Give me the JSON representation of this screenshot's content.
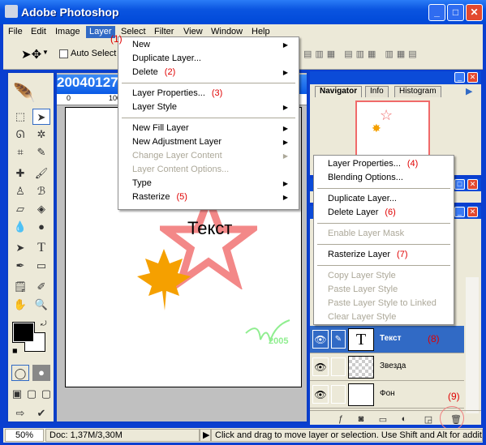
{
  "window": {
    "title": "Adobe Photoshop",
    "buttons": {
      "minimize": "_",
      "maximize": "□",
      "close": "✕"
    }
  },
  "menubar": {
    "items": [
      "File",
      "Edit",
      "Image",
      "Layer",
      "Select",
      "Filter",
      "View",
      "Window",
      "Help"
    ],
    "active": "Layer"
  },
  "options": {
    "auto_select": "Auto Select L"
  },
  "document": {
    "title": "20040127.p",
    "ruler": [
      "0",
      "100"
    ],
    "canvas_text": "Текст",
    "watermark": "2005"
  },
  "colors": {
    "accent": "#316ac5",
    "annotation": "#e00000",
    "titlebar": "#0054e3",
    "star": "#f06a6a",
    "leaf": "#f5a000",
    "watermark": "#90ee90"
  },
  "navigator": {
    "tabs": [
      "Navigator",
      "Info",
      "Histogram"
    ]
  },
  "layers": [
    {
      "name": "Текст",
      "thumb": "T",
      "selected": true,
      "annotation": "(8)"
    },
    {
      "name": "Звезда",
      "thumb": "",
      "selected": false
    },
    {
      "name": "Фон",
      "thumb": "",
      "selected": false
    }
  ],
  "layers_footer": {
    "icons": [
      "layer-style-icon",
      "mask-icon",
      "folder-icon",
      "adjustment-icon",
      "new-layer-icon",
      "trash-icon"
    ],
    "annotation": "(9)"
  },
  "layer_menu": {
    "annotation": "(1)",
    "items": [
      {
        "label": "New",
        "submenu": true
      },
      {
        "label": "Duplicate Layer..."
      },
      {
        "label": "Delete",
        "submenu": true,
        "annotation": "(2)"
      },
      {
        "label": "Layer Properties...",
        "annotation": "(3)"
      },
      {
        "label": "Layer Style",
        "submenu": true
      },
      {
        "label": "New Fill Layer",
        "submenu": true
      },
      {
        "label": "New Adjustment Layer",
        "submenu": true
      },
      {
        "label": "Change Layer Content",
        "submenu": true,
        "disabled": true
      },
      {
        "label": "Layer Content Options...",
        "disabled": true
      },
      {
        "label": "Type",
        "submenu": true
      },
      {
        "label": "Rasterize",
        "submenu": true,
        "annotation": "(5)"
      }
    ]
  },
  "context_menu": {
    "items": [
      {
        "label": "Layer Properties...",
        "annotation": "(4)"
      },
      {
        "label": "Blending Options..."
      },
      {
        "label": "Duplicate Layer..."
      },
      {
        "label": "Delete Layer",
        "annotation": "(6)"
      },
      {
        "label": "Enable Layer Mask",
        "disabled": true
      },
      {
        "label": "Rasterize Layer",
        "annotation": "(7)"
      },
      {
        "label": "Copy Layer Style",
        "disabled": true
      },
      {
        "label": "Paste Layer Style",
        "disabled": true
      },
      {
        "label": "Paste Layer Style to Linked",
        "disabled": true
      },
      {
        "label": "Clear Layer Style",
        "disabled": true
      }
    ]
  },
  "statusbar": {
    "zoom": "50%",
    "doc": "Doc: 1,37M/3,30M",
    "hint": "Click and drag to move layer or selection.  Use Shift and Alt for additional"
  }
}
